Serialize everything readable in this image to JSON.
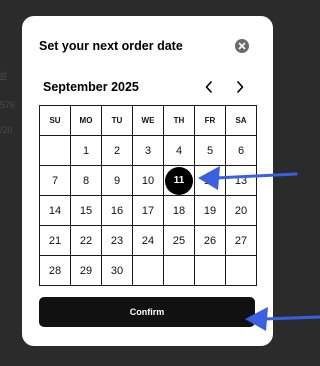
{
  "background": {
    "fragments": [
      "ilt",
      "576",
      "/20"
    ]
  },
  "modal": {
    "title": "Set your next order date",
    "close_icon": "close-circle-icon"
  },
  "calendar": {
    "month_label": "September 2025",
    "prev_icon": "chevron-left-icon",
    "next_icon": "chevron-right-icon",
    "weekdays": [
      "SU",
      "MO",
      "TU",
      "WE",
      "TH",
      "FR",
      "SA"
    ],
    "weeks": [
      [
        "",
        "1",
        "2",
        "3",
        "4",
        "5",
        "6"
      ],
      [
        "7",
        "8",
        "9",
        "10",
        "11",
        "12",
        "13"
      ],
      [
        "14",
        "15",
        "16",
        "17",
        "18",
        "19",
        "20"
      ],
      [
        "21",
        "22",
        "23",
        "24",
        "25",
        "26",
        "27"
      ],
      [
        "28",
        "29",
        "30",
        "",
        "",
        "",
        ""
      ]
    ],
    "selected_day": "11"
  },
  "confirm_label": "Confirm",
  "colors": {
    "annotation_arrow": "#3a5fe0",
    "selected_day_bg": "#000000",
    "confirm_bg": "#111111"
  }
}
